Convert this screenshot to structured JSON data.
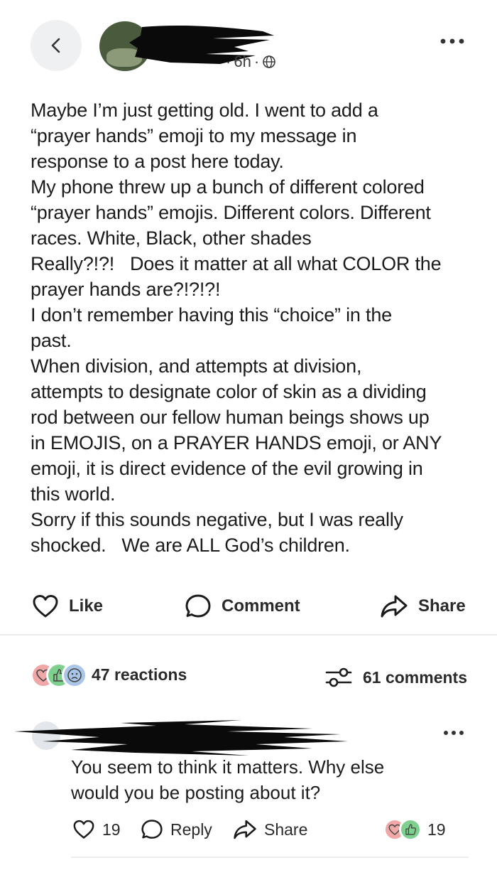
{
  "post": {
    "time": "6h",
    "separator": "·",
    "lines": [
      "Maybe I’m just getting old. I went to add a",
      "“prayer hands” emoji to my message in",
      "response to a post here today.",
      "My phone threw up a bunch of different colored",
      "“prayer hands” emojis. Different colors. Different",
      "races. White, Black, other shades",
      "Really?!?!   Does it matter at all what COLOR the",
      "prayer hands are?!?!?!",
      "I don’t remember having this “choice” in the",
      "past.",
      "When division, and attempts at division,",
      "attempts to designate color of skin as a dividing",
      "rod between our fellow human beings shows up",
      "in EMOJIS, on a PRAYER HANDS emoji, or ANY",
      "emoji, it is direct evidence of the evil growing in",
      "this world.",
      "Sorry if this sounds negative, but I was really",
      "shocked.   We are ALL God’s children."
    ]
  },
  "actions": {
    "like": "Like",
    "comment": "Comment",
    "share": "Share"
  },
  "stats": {
    "reactions": "47 reactions",
    "comments": "61 comments"
  },
  "comment": {
    "text_line1": "You seem to think it matters. Why else",
    "text_line2": "would you be posting about it?",
    "like_count": "19",
    "reply": "Reply",
    "share": "Share",
    "reaction_count": "19"
  },
  "colors": {
    "heart_reaction": "#f0a7a7",
    "thumbs_reaction": "#7fcf8e",
    "sad_reaction": "#a9c6e8",
    "redaction": "#0a0a0a"
  },
  "icons": {
    "back": "chevron-left-icon",
    "globe": "globe-icon",
    "more": "more-dots-icon",
    "like": "heart-icon",
    "comment": "speech-bubble-icon",
    "share": "share-arrow-icon",
    "comments": "sliders-icon"
  }
}
